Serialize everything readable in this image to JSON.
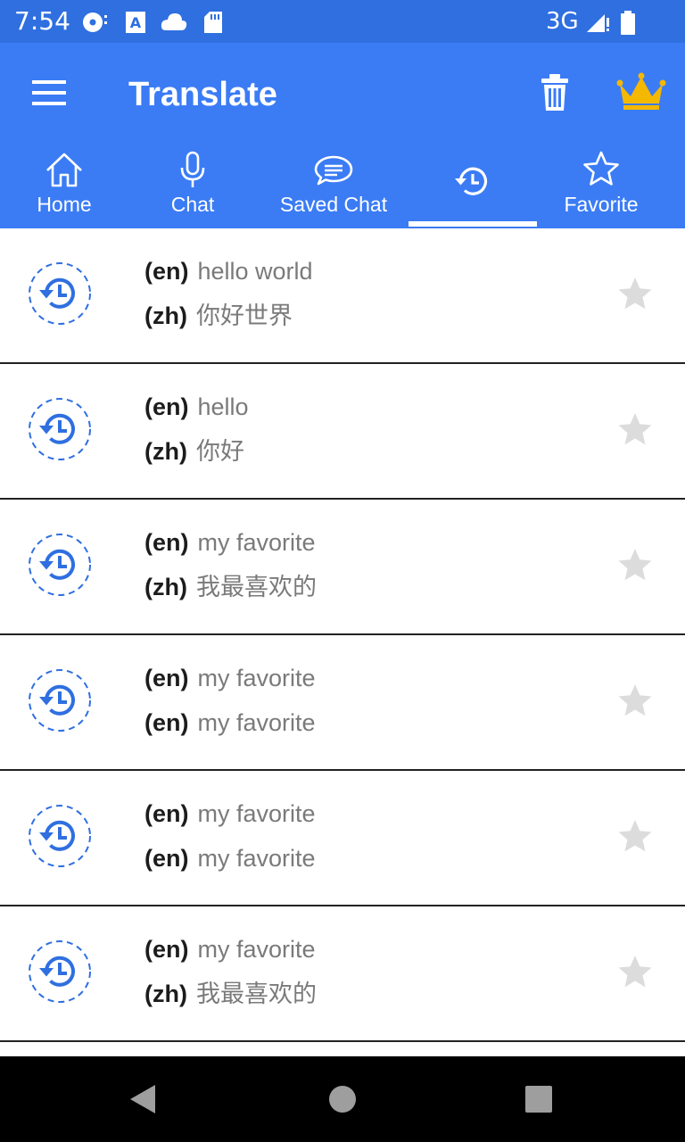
{
  "status_bar": {
    "time": "7:54",
    "network": "3G",
    "icons": [
      "media-icon",
      "a-icon",
      "cloud-icon",
      "sd-card-icon",
      "signal-icon",
      "battery-icon"
    ]
  },
  "app_bar": {
    "title": "Translate",
    "actions": [
      "trash-icon",
      "crown-icon"
    ],
    "accent_color": "#3b7cf5",
    "crown_color": "#f5b800"
  },
  "tabs": [
    {
      "label": "Home",
      "icon": "home-icon"
    },
    {
      "label": "Chat",
      "icon": "microphone-icon"
    },
    {
      "label": "Saved Chat",
      "icon": "chat-bubble-icon"
    },
    {
      "label": "",
      "icon": "history-icon",
      "selected": true
    },
    {
      "label": "Favorite",
      "icon": "star-outline-icon"
    }
  ],
  "history": [
    {
      "src_code": "(en)",
      "src_text": "hello world",
      "dst_code": "(zh)",
      "dst_text": "你好世界"
    },
    {
      "src_code": "(en)",
      "src_text": "hello",
      "dst_code": "(zh)",
      "dst_text": "你好"
    },
    {
      "src_code": "(en)",
      "src_text": "my favorite",
      "dst_code": "(zh)",
      "dst_text": "我最喜欢的"
    },
    {
      "src_code": "(en)",
      "src_text": "my favorite",
      "dst_code": "(en)",
      "dst_text": "my favorite"
    },
    {
      "src_code": "(en)",
      "src_text": "my favorite",
      "dst_code": "(en)",
      "dst_text": "my favorite"
    },
    {
      "src_code": "(en)",
      "src_text": "my favorite",
      "dst_code": "(zh)",
      "dst_text": "我最喜欢的"
    }
  ],
  "nav_bar": {
    "buttons": [
      "back-icon",
      "home-circle-icon",
      "recents-icon"
    ]
  }
}
